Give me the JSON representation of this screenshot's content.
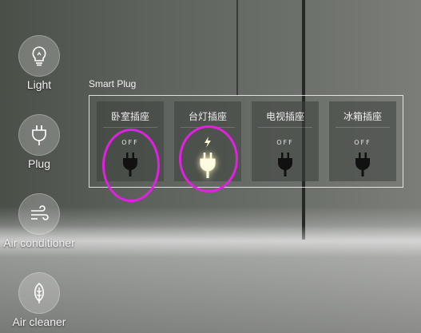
{
  "sidebar": {
    "items": [
      {
        "label": "Light",
        "icon": "bulb-icon"
      },
      {
        "label": "Plug",
        "icon": "plug-icon"
      },
      {
        "label": "Air conditioner",
        "icon": "wind-icon"
      },
      {
        "label": "Air cleaner",
        "icon": "leaf-icon"
      }
    ]
  },
  "panel": {
    "title": "Smart Plug",
    "plugs": [
      {
        "name": "卧室插座",
        "status": "OFF",
        "on": false
      },
      {
        "name": "台灯插座",
        "status": "",
        "on": true
      },
      {
        "name": "电视插座",
        "status": "OFF",
        "on": false
      },
      {
        "name": "冰箱插座",
        "status": "OFF",
        "on": false
      }
    ]
  },
  "colors": {
    "annotation": "#e021e0",
    "plug_off": "#111111",
    "plug_on": "#fffbe0"
  }
}
